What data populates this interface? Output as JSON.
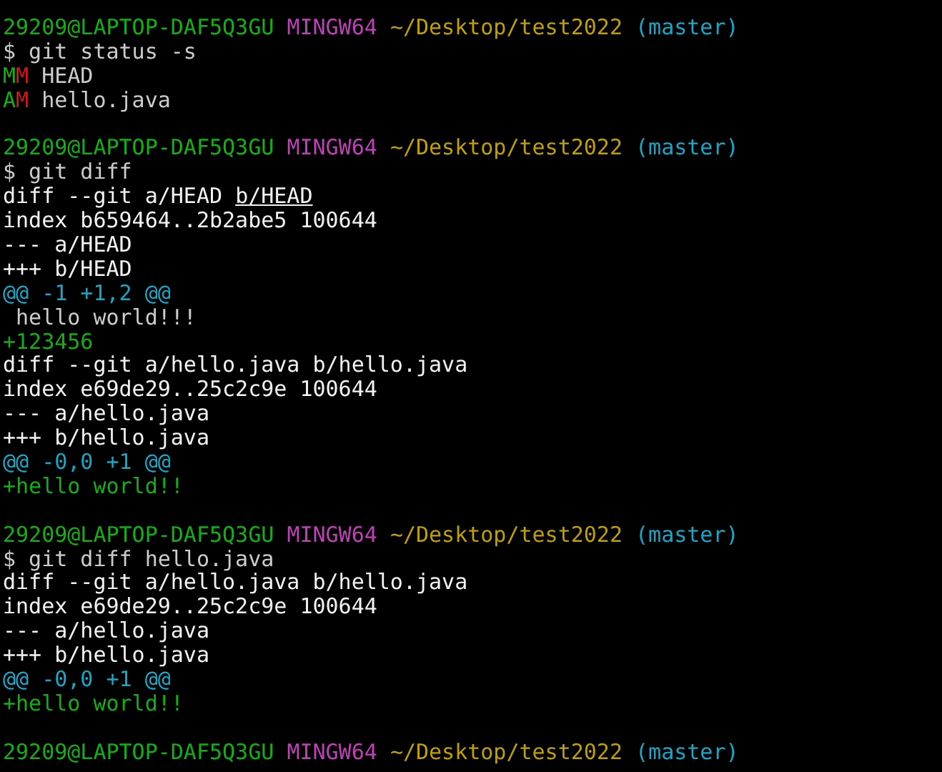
{
  "terminal": {
    "lines": [
      {
        "kind": "prompt",
        "user_host": "29209@LAPTOP-DAF5Q3GU",
        "system": "MINGW64",
        "path": "~/Desktop/test2022",
        "branch": "(master)"
      },
      {
        "kind": "command",
        "text": "$ git status -s"
      },
      {
        "kind": "status",
        "index_code": "M",
        "worktree_code": "M",
        "file": "HEAD"
      },
      {
        "kind": "status",
        "index_code": "A",
        "worktree_code": "M",
        "file": "hello.java"
      },
      {
        "kind": "blank"
      },
      {
        "kind": "prompt",
        "user_host": "29209@LAPTOP-DAF5Q3GU",
        "system": "MINGW64",
        "path": "~/Desktop/test2022",
        "branch": "(master)"
      },
      {
        "kind": "command",
        "text": "$ git diff"
      },
      {
        "kind": "meta",
        "segments": [
          {
            "text": "diff --git a/HEAD ",
            "underlined": false
          },
          {
            "text": "b/HEAD",
            "underlined": true
          }
        ]
      },
      {
        "kind": "meta",
        "segments": [
          {
            "text": "index b659464..2b2abe5 100644",
            "underlined": false
          }
        ]
      },
      {
        "kind": "meta",
        "segments": [
          {
            "text": "--- a/HEAD",
            "underlined": false
          }
        ]
      },
      {
        "kind": "meta",
        "segments": [
          {
            "text": "+++ b/HEAD",
            "underlined": false
          }
        ]
      },
      {
        "kind": "hunk",
        "text": "@@ -1 +1,2 @@"
      },
      {
        "kind": "context",
        "text": " hello world!!!"
      },
      {
        "kind": "added",
        "text": "+123456"
      },
      {
        "kind": "meta",
        "segments": [
          {
            "text": "diff --git a/hello.java b/hello.java",
            "underlined": false
          }
        ]
      },
      {
        "kind": "meta",
        "segments": [
          {
            "text": "index e69de29..25c2c9e 100644",
            "underlined": false
          }
        ]
      },
      {
        "kind": "meta",
        "segments": [
          {
            "text": "--- a/hello.java",
            "underlined": false
          }
        ]
      },
      {
        "kind": "meta",
        "segments": [
          {
            "text": "+++ b/hello.java",
            "underlined": false
          }
        ]
      },
      {
        "kind": "hunk",
        "text": "@@ -0,0 +1 @@"
      },
      {
        "kind": "added",
        "text": "+hello world!!"
      },
      {
        "kind": "blank"
      },
      {
        "kind": "prompt",
        "user_host": "29209@LAPTOP-DAF5Q3GU",
        "system": "MINGW64",
        "path": "~/Desktop/test2022",
        "branch": "(master)"
      },
      {
        "kind": "command",
        "text": "$ git diff hello.java"
      },
      {
        "kind": "meta",
        "segments": [
          {
            "text": "diff --git a/hello.java b/hello.java",
            "underlined": false
          }
        ]
      },
      {
        "kind": "meta",
        "segments": [
          {
            "text": "index e69de29..25c2c9e 100644",
            "underlined": false
          }
        ]
      },
      {
        "kind": "meta",
        "segments": [
          {
            "text": "--- a/hello.java",
            "underlined": false
          }
        ]
      },
      {
        "kind": "meta",
        "segments": [
          {
            "text": "+++ b/hello.java",
            "underlined": false
          }
        ]
      },
      {
        "kind": "hunk",
        "text": "@@ -0,0 +1 @@"
      },
      {
        "kind": "added",
        "text": "+hello world!!"
      },
      {
        "kind": "blank"
      },
      {
        "kind": "prompt",
        "user_host": "29209@LAPTOP-DAF5Q3GU",
        "system": "MINGW64",
        "path": "~/Desktop/test2022",
        "branch": "(master)"
      }
    ]
  }
}
